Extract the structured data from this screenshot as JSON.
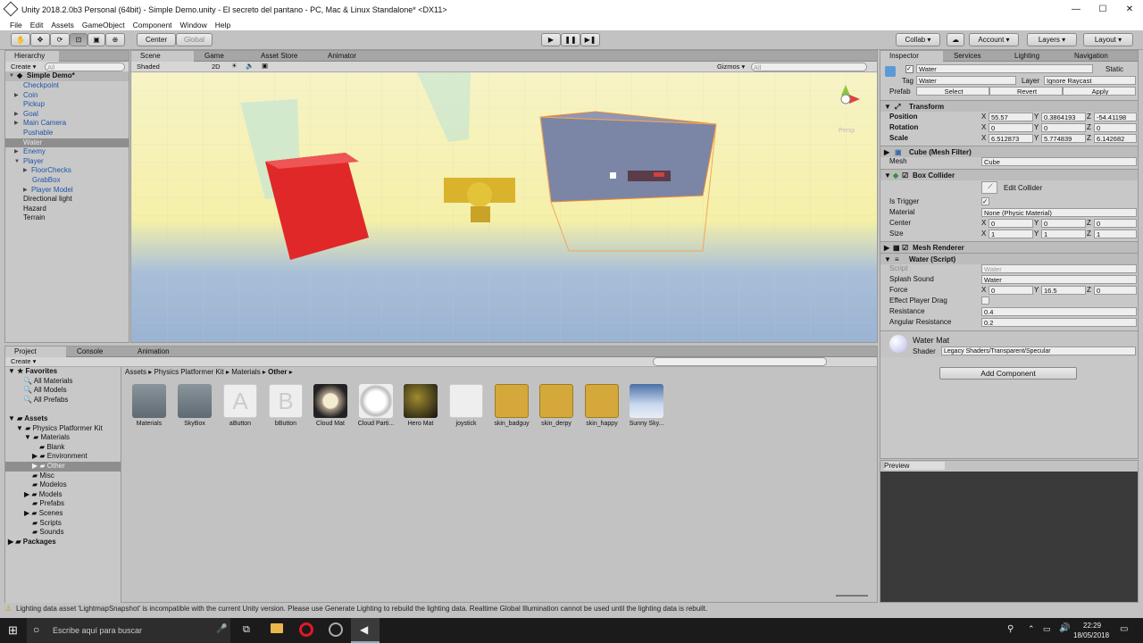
{
  "window": {
    "title": "Unity 2018.2.0b3 Personal (64bit) - Simple Demo.unity - El secreto del pantano - PC, Mac & Linux Standalone* <DX11>",
    "minimize": "—",
    "maximize": "☐",
    "close": "✕"
  },
  "menu": [
    "File",
    "Edit",
    "Assets",
    "GameObject",
    "Component",
    "Window",
    "Help"
  ],
  "toolbar": {
    "center": "Center",
    "global": "Global",
    "collab": "Collab ▾",
    "account": "Account",
    "layers": "Layers",
    "layout": "Layout",
    "play": "▶",
    "pause": "❚❚",
    "step": "▶❚"
  },
  "hierarchy": {
    "tab": "Hierarchy",
    "create": "Create ▾",
    "search_placeholder": "All",
    "scene": "Simple Demo*",
    "items": [
      "Checkpoint",
      "Coin",
      "Pickup",
      "Goal",
      "Main Camera",
      "Pushable",
      "Water",
      "Enemy",
      "Player",
      "FloorChecks",
      "GrabBox",
      "Player Model",
      "Directional light",
      "Hazard",
      "Terrain"
    ]
  },
  "scene_view": {
    "tabs": [
      "Scene",
      "Game",
      "Asset Store",
      "Animator"
    ],
    "shaded": "Shaded",
    "mode_2d": "2D",
    "gizmos": "Gizmos ▾",
    "search_placeholder": "All",
    "persp": "Persp"
  },
  "inspector": {
    "tabs": [
      "Inspector",
      "Services",
      "Lighting",
      "Navigation"
    ],
    "name": "Water",
    "static": "Static",
    "tag_label": "Tag",
    "tag": "Water",
    "layer_label": "Layer",
    "layer": "Ignore Raycast",
    "prefab_label": "Prefab",
    "select": "Select",
    "revert": "Revert",
    "apply": "Apply",
    "transform": {
      "title": "Transform",
      "position_label": "Position",
      "position": {
        "x": "55.57",
        "y": "0.3864193",
        "z": "-54.41198"
      },
      "rotation_label": "Rotation",
      "rotation": {
        "x": "0",
        "y": "0",
        "z": "0"
      },
      "scale_label": "Scale",
      "scale": {
        "x": "6.512873",
        "y": "5.774839",
        "z": "6.142682"
      }
    },
    "mesh_filter": {
      "title": "Cube (Mesh Filter)",
      "mesh_label": "Mesh",
      "mesh": "Cube"
    },
    "box_collider": {
      "title": "Box Collider",
      "edit": "Edit Collider",
      "is_trigger": "Is Trigger",
      "material_label": "Material",
      "material": "None (Physic Material)",
      "center_label": "Center",
      "center": {
        "x": "0",
        "y": "0",
        "z": "0"
      },
      "size_label": "Size",
      "size": {
        "x": "1",
        "y": "1",
        "z": "1"
      }
    },
    "mesh_renderer": {
      "title": "Mesh Renderer"
    },
    "water_script": {
      "title": "Water (Script)",
      "script_label": "Script",
      "script": "Water",
      "splash_label": "Splash Sound",
      "splash": "Water",
      "force_label": "Force",
      "force": {
        "x": "0",
        "y": "16.5",
        "z": "0"
      },
      "drag_label": "Effect Player Drag",
      "resistance_label": "Resistance",
      "resistance": "0.4",
      "angular_label": "Angular Resistance",
      "angular": "0.2"
    },
    "material": {
      "name": "Water Mat",
      "shader_label": "Shader",
      "shader": "Legacy Shaders/Transparent/Specular"
    },
    "add_component": "Add Component",
    "preview": "Preview",
    "axis": {
      "x": "X",
      "y": "Y",
      "z": "Z"
    }
  },
  "project": {
    "tabs": [
      "Project",
      "Console",
      "Animation"
    ],
    "create": "Create ▾",
    "breadcrumb": {
      "b1": "Assets",
      "b2": "Physics Platformer Kit",
      "b3": "Materials",
      "b4": "Other",
      "sep": "▸"
    },
    "favorites": "Favorites",
    "fav_items": [
      "All Materials",
      "All Models",
      "All Prefabs"
    ],
    "assets": "Assets",
    "tree": [
      "Physics Platformer Kit",
      "Materials",
      "Blank",
      "Environment",
      "Other",
      "Misc",
      "Modelos",
      "Models",
      "Prefabs",
      "Scenes",
      "Scripts",
      "Sounds"
    ],
    "packages": "Packages",
    "grid": [
      "Materials",
      "SkyBox",
      "aButton",
      "bButton",
      "Cloud Mat",
      "Cloud Parti...",
      "Hero Mat",
      "joystick",
      "skin_badguy",
      "skin_derpy",
      "skin_happy",
      "Sunny Sky..."
    ],
    "glyph_a": "A",
    "glyph_b": "B"
  },
  "status": "Lighting data asset 'LightmapSnapshot' is incompatible with the current Unity version. Please use Generate Lighting to rebuild the lighting data. Realtime Global Illumination cannot be used until the lighting data is rebuilt.",
  "taskbar": {
    "search": "Escribe aquí para buscar",
    "time": "22:29",
    "date": "18/05/2018"
  }
}
